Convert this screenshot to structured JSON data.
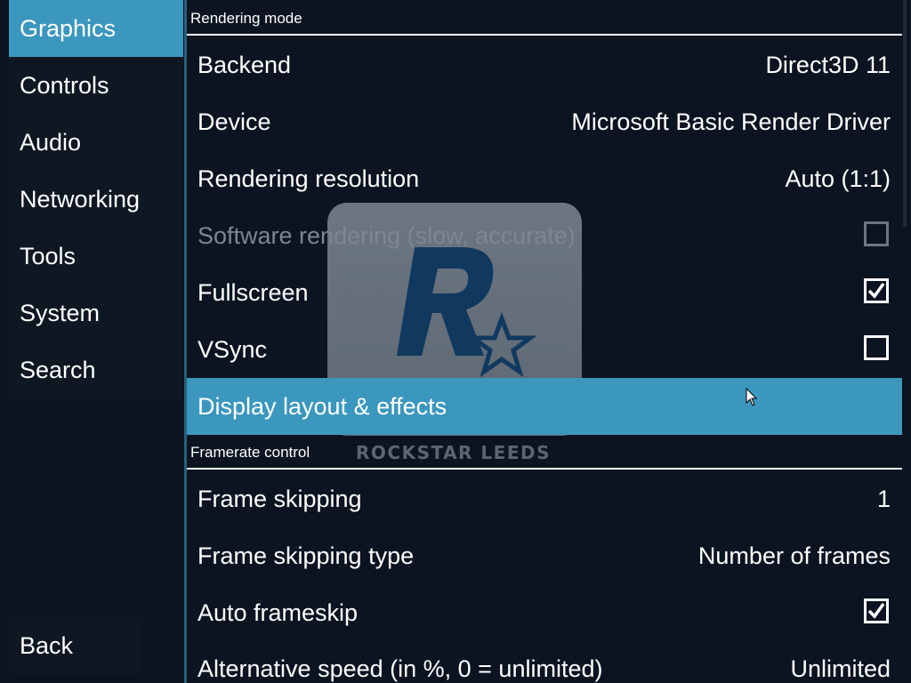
{
  "watermark": {
    "logo_letter": "R",
    "text": "ROCKSTAR LEEDS"
  },
  "sidebar": {
    "items": [
      {
        "label": "Graphics",
        "active": true
      },
      {
        "label": "Controls"
      },
      {
        "label": "Audio"
      },
      {
        "label": "Networking"
      },
      {
        "label": "Tools"
      },
      {
        "label": "System"
      },
      {
        "label": "Search"
      }
    ],
    "back_label": "Back"
  },
  "sections": {
    "rendering": {
      "title": "Rendering mode",
      "rows": {
        "backend": {
          "label": "Backend",
          "value": "Direct3D 11"
        },
        "device": {
          "label": "Device",
          "value": "Microsoft Basic Render Driver"
        },
        "resolution": {
          "label": "Rendering resolution",
          "value": "Auto (1:1)"
        },
        "software": {
          "label": "Software rendering (slow, accurate)",
          "checked": false,
          "disabled": true
        },
        "fullscreen": {
          "label": "Fullscreen",
          "checked": true
        },
        "vsync": {
          "label": "VSync",
          "checked": false
        },
        "display": {
          "label": "Display layout & effects"
        }
      }
    },
    "framerate": {
      "title": "Framerate control",
      "rows": {
        "frameskip": {
          "label": "Frame skipping",
          "value": "1"
        },
        "frameskip_type": {
          "label": "Frame skipping type",
          "value": "Number of frames"
        },
        "auto_frameskip": {
          "label": "Auto frameskip",
          "checked": true
        },
        "alt_speed": {
          "label": "Alternative speed (in %, 0 = unlimited)",
          "value": "Unlimited"
        }
      }
    }
  },
  "colors": {
    "accent": "#3b97be",
    "background": "#0b1420",
    "disabled_text": "#7d8790"
  }
}
